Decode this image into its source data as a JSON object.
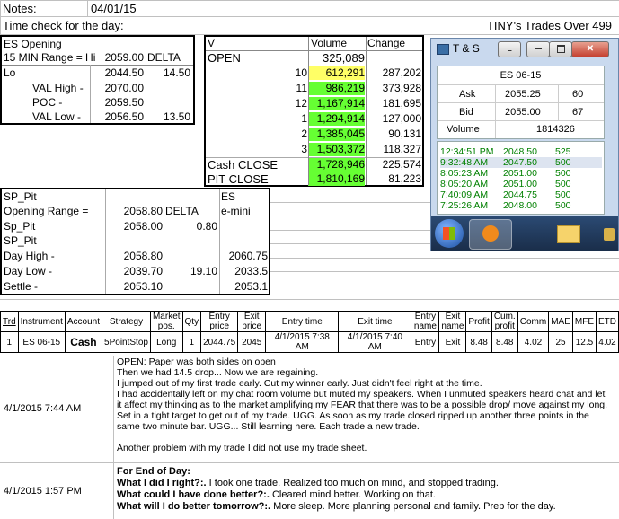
{
  "notes": {
    "label": "Notes:",
    "date": "04/01/15"
  },
  "time_check": {
    "label": "Time check for the day:",
    "right": "TINY's Trades Over 499"
  },
  "es_opening": {
    "title": "ES Opening",
    "range_label": "15 MIN Range = Hi",
    "range_hi": "2059.00",
    "delta_label": "DELTA",
    "lo_label": "Lo",
    "lo": "2044.50",
    "delta": "14.50",
    "val_high_label": "VAL High  -",
    "val_high": "2070.00",
    "poc_label": "POC  -",
    "poc": "2059.50",
    "val_low_label": "VAL Low  -",
    "val_low": "2056.50",
    "val_delta": "13.50"
  },
  "volume_table": {
    "headers": {
      "v": "V",
      "volume": "Volume",
      "change": "Change"
    },
    "open": {
      "label": "OPEN",
      "volume": "325,089"
    },
    "rows": [
      {
        "hour": "10",
        "volume": "612,291",
        "change": "287,202"
      },
      {
        "hour": "11",
        "volume": "986,219",
        "change": "373,928"
      },
      {
        "hour": "12",
        "volume": "1,167,914",
        "change": "181,695"
      },
      {
        "hour": "1",
        "volume": "1,294,914",
        "change": "127,000"
      },
      {
        "hour": "2",
        "volume": "1,385,045",
        "change": "90,131"
      },
      {
        "hour": "3",
        "volume": "1,503,372",
        "change": "118,327"
      }
    ],
    "cash_close": {
      "label": "Cash CLOSE",
      "volume": "1,728,946",
      "change": "225,574"
    },
    "pit_close": {
      "label": "PIT CLOSE",
      "volume": "1,810,169",
      "change": "81,223"
    }
  },
  "sp_pit": {
    "title": "SP_Pit",
    "es_label": "ES",
    "emini_label": "e-mini",
    "opening_range_label": "Opening Range =",
    "opening_range": "2058.80",
    "delta_label": "DELTA",
    "sp_pit_label": "Sp_Pit",
    "sp_pit_val": "2058.00",
    "delta": "0.80",
    "sp_pit2_label": "SP_Pit",
    "day_high_label": "Day High -",
    "day_high": "2058.80",
    "day_high_es": "2060.75",
    "day_low_label": "Day Low -",
    "day_low": "2039.70",
    "day_low_delta": "19.10",
    "day_low_es": "2033.5",
    "settle_label": "Settle -",
    "settle": "2053.10",
    "settle_es": "2053.1"
  },
  "ts_window": {
    "title": "T & S",
    "btn_l": "L",
    "symbol": "ES 06-15",
    "ask_label": "Ask",
    "ask": "2055.25",
    "ask_size": "60",
    "bid_label": "Bid",
    "bid": "2055.00",
    "bid_size": "67",
    "volume_label": "Volume",
    "volume": "1814326",
    "trades": [
      {
        "time": "12:34:51 PM",
        "price": "2048.50",
        "size": "525"
      },
      {
        "time": "9:32:48 AM",
        "price": "2047.50",
        "size": "500"
      },
      {
        "time": "8:05:23 AM",
        "price": "2051.00",
        "size": "500"
      },
      {
        "time": "8:05:20 AM",
        "price": "2051.00",
        "size": "500"
      },
      {
        "time": "7:40:09 AM",
        "price": "2044.75",
        "size": "500"
      },
      {
        "time": "7:25:26 AM",
        "price": "2048.00",
        "size": "500"
      }
    ]
  },
  "trades_table": {
    "headers": [
      "Trd",
      "Instrument",
      "Account",
      "Strategy",
      "Market pos.",
      "Qty",
      "Entry price",
      "Exit price",
      "Entry time",
      "Exit time",
      "Entry name",
      "Exit name",
      "Profit",
      "Cum. profit",
      "Comm",
      "MAE",
      "MFE",
      "ETD"
    ],
    "row": [
      "1",
      "ES 06-15",
      "Cash",
      "5PointStop",
      "Long",
      "1",
      "2044.75",
      "2045",
      "4/1/2015 7:38 AM",
      "4/1/2015 7:40 AM",
      "Entry",
      "Exit",
      "8.48",
      "8.48",
      "4.02",
      "25",
      "12.5",
      "4.02"
    ]
  },
  "journal": [
    {
      "timestamp": "4/1/2015 7:44 AM",
      "lines": [
        "OPEN: Paper was both sides on open",
        "Then we had 14.5 drop...  Now we are regaining.",
        "I jumped out of my first trade early.  Cut my winner early.  Just didn't feel right at the time.",
        "I had accidentally left on my chat room volume but muted my speakers.  When I unmuted speakers heard chat and let",
        "it affect my thinking as to the market amplifying my FEAR that there was to be a possible drop/ move against my long.",
        "Set in a tight target to get out of my trade.  UGG.   As soon as my trade closed ripped up another three points in the",
        "same two minute bar.  UGG... Still learning here.  Each trade a new trade.",
        "",
        "Another problem with my trade I did not use my trade sheet."
      ]
    },
    {
      "timestamp": "4/1/2015 1:57 PM",
      "eod_title": "For End of Day:",
      "q1": "What I did I right?:.",
      "a1": "  I took one trade.  Realized too much on mind, and stopped trading.",
      "q2": "What could I have done better?:.",
      "a2": "  Cleared mind better.  Working on that.",
      "q3": "What will I do better tomorrow?:.",
      "a3": "  More sleep.  More planning personal and family.  Prep for the day."
    }
  ]
}
